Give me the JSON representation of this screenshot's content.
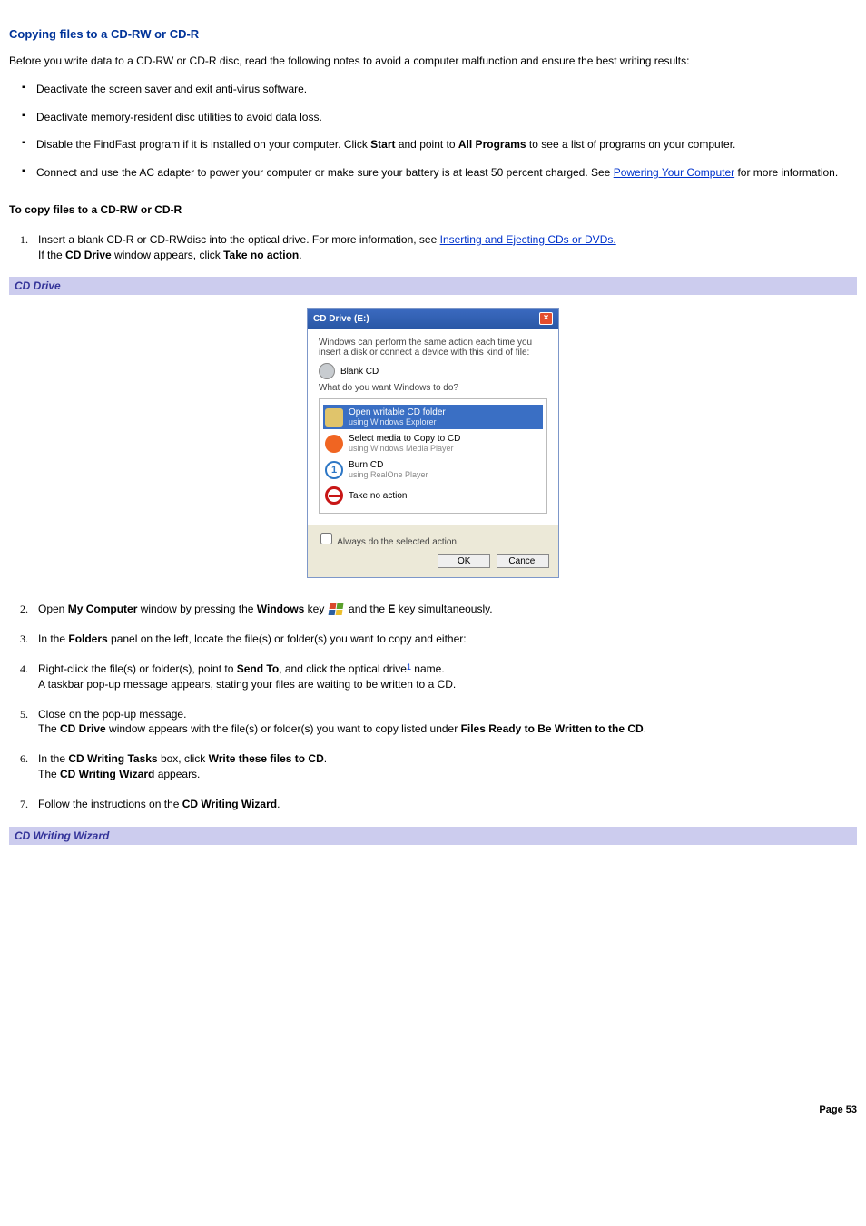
{
  "headings": {
    "main": "Copying files to a CD-RW or CD-R",
    "intro": "Before you write data to a CD-RW or CD-R disc, read the following notes to avoid a computer malfunction and ensure the best writing results:",
    "sub": "To copy files to a CD-RW or CD-R"
  },
  "bullets": {
    "b1": "Deactivate the screen saver and exit anti-virus software.",
    "b2": "Deactivate memory-resident disc utilities to avoid data loss.",
    "b3_a": "Disable the FindFast program if it is installed on your computer. Click ",
    "b3_start": "Start",
    "b3_b": " and point to ",
    "b3_allprograms": "All Programs",
    "b3_c": " to see a list of programs on your computer.",
    "b4_a": "Connect and use the AC adapter to power your computer or make sure your battery is at least 50 percent charged. See ",
    "b4_link": "Powering Your Computer",
    "b4_b": " for more information."
  },
  "steps": {
    "s1_a": "Insert a blank CD-R or CD-RWdisc into the optical drive. For more information, see ",
    "s1_link": "Inserting and Ejecting CDs or DVDs.",
    "s1_b_a": "If the ",
    "s1_b_cddrive": "CD Drive",
    "s1_b_b": " window appears, click ",
    "s1_b_tna": "Take no action",
    "s1_b_c": ".",
    "s2_a": "Open ",
    "s2_mycomp": "My Computer",
    "s2_b": " window by pressing the ",
    "s2_win": "Windows",
    "s2_c": " key ",
    "s2_d": " and the ",
    "s2_e": "E",
    "s2_f": " key simultaneously.",
    "s3_a": "In the ",
    "s3_folders": "Folders",
    "s3_b": " panel on the left, locate the file(s) or folder(s) you want to copy and either:",
    "s4_a": "Right-click the file(s) or folder(s), point to ",
    "s4_sendto": "Send To",
    "s4_b": ", and click the optical drive",
    "s4_sup": "1",
    "s4_c": " name.",
    "s4_line2": "A taskbar pop-up message appears, stating your files are waiting to be written to a CD.",
    "s5_a": "Close on the pop-up message.",
    "s5_b_a": "The ",
    "s5_b_cddrive": "CD Drive",
    "s5_b_b": " window appears with the file(s) or folder(s) you want to copy listed under ",
    "s5_b_ready": "Files Ready to Be Written to the CD",
    "s5_b_c": ".",
    "s6_a": "In the ",
    "s6_tasks": "CD Writing Tasks",
    "s6_b": " box, click ",
    "s6_write": "Write these files to CD",
    "s6_c": ".",
    "s6_d_a": "The ",
    "s6_d_wizard": "CD Writing Wizard",
    "s6_d_b": " appears.",
    "s7_a": "Follow the instructions on the ",
    "s7_wizard": "CD Writing Wizard",
    "s7_b": "."
  },
  "captions": {
    "cddrive": "CD Drive",
    "cdwizard": "CD Writing Wizard"
  },
  "dialog": {
    "title": "CD Drive (E:)",
    "line1": "Windows can perform the same action each time you insert a disk or connect a device with this kind of file:",
    "blankcd": "Blank CD",
    "prompt": "What do you want Windows to do?",
    "opt1_t": "Open writable CD folder",
    "opt1_s": "using Windows Explorer",
    "opt2_t": "Select media to Copy to CD",
    "opt2_s": "using Windows Media Player",
    "opt3_t": "Burn CD",
    "opt3_s": "using RealOne Player",
    "opt4_t": "Take no action",
    "always": "Always do the selected action.",
    "ok": "OK",
    "cancel": "Cancel"
  },
  "footer": {
    "page": "Page 53"
  }
}
